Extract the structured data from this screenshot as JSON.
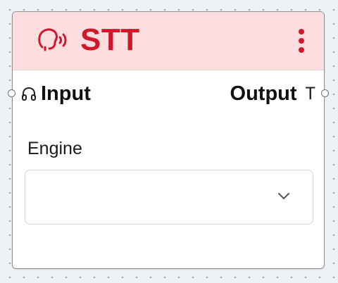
{
  "node": {
    "title": "STT",
    "header_icon": "speech-to-text-icon",
    "menu_icon": "more-vertical-icon",
    "accent_color": "#d0182b",
    "header_background": "#fcdde0"
  },
  "ports": {
    "input": {
      "label": "Input",
      "icon": "headphones-icon"
    },
    "output": {
      "label": "Output",
      "icon": "text-type-icon",
      "glyph": "T"
    }
  },
  "fields": {
    "engine": {
      "label": "Engine",
      "value": "",
      "icon": "chevron-down-icon"
    }
  }
}
